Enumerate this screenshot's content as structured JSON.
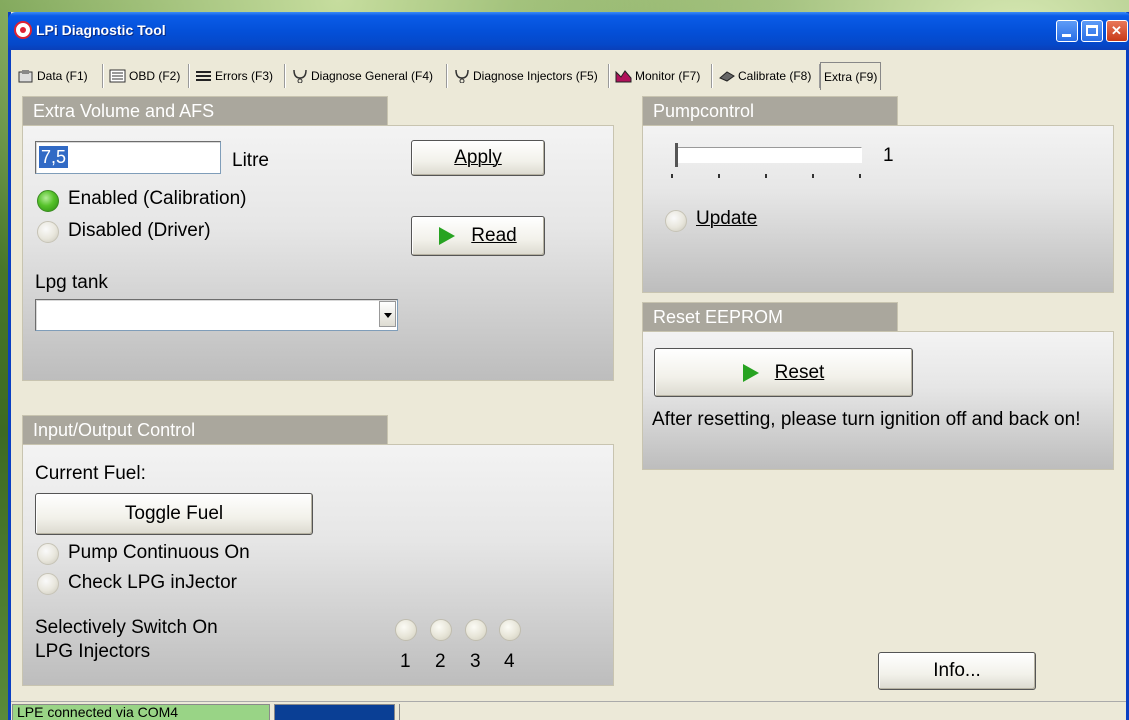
{
  "window": {
    "title": "LPi Diagnostic Tool"
  },
  "tabs": [
    {
      "label": "Data (F1)",
      "icon": "data-icon"
    },
    {
      "label": "OBD (F2)",
      "icon": "obd-icon"
    },
    {
      "label": "Errors (F3)",
      "icon": "errors-icon"
    },
    {
      "label": "Diagnose General (F4)",
      "icon": "stethoscope-icon"
    },
    {
      "label": "Diagnose Injectors (F5)",
      "icon": "stethoscope-icon"
    },
    {
      "label": "Monitor (F7)",
      "icon": "monitor-icon"
    },
    {
      "label": "Calibrate (F8)",
      "icon": "chip-icon"
    },
    {
      "label": "Extra (F9)",
      "icon": ""
    }
  ],
  "extra_volume": {
    "header": "Extra Volume and AFS",
    "volume_value": "7,5",
    "volume_unit": "Litre",
    "apply_label": "Apply",
    "read_label": "Read",
    "enabled_label": "Enabled (Calibration)",
    "disabled_label": "Disabled (Driver)",
    "selected_mode": "enabled",
    "tank_label": "Lpg tank",
    "tank_value": ""
  },
  "io_control": {
    "header": "Input/Output Control",
    "current_fuel_label": "Current Fuel:",
    "toggle_fuel_label": "Toggle Fuel",
    "pump_label": "Pump Continuous On",
    "check_injector_label": "Check LPG inJector",
    "selective_line1": "Selectively Switch On",
    "selective_line2": "LPG Injectors",
    "injectors": [
      "1",
      "2",
      "3",
      "4"
    ]
  },
  "pumpcontrol": {
    "header": "Pumpcontrol",
    "slider_value": "1",
    "slider_fraction": 0,
    "update_label": "Update"
  },
  "reset": {
    "header": "Reset EEPROM",
    "button_label": "Reset",
    "message": "After resetting, please turn ignition off and back on!"
  },
  "info_label": "Info...",
  "status": {
    "connection": "LPE connected via COM4",
    "connection_color": "#99d486",
    "indicator_color": "#0a3f95"
  }
}
